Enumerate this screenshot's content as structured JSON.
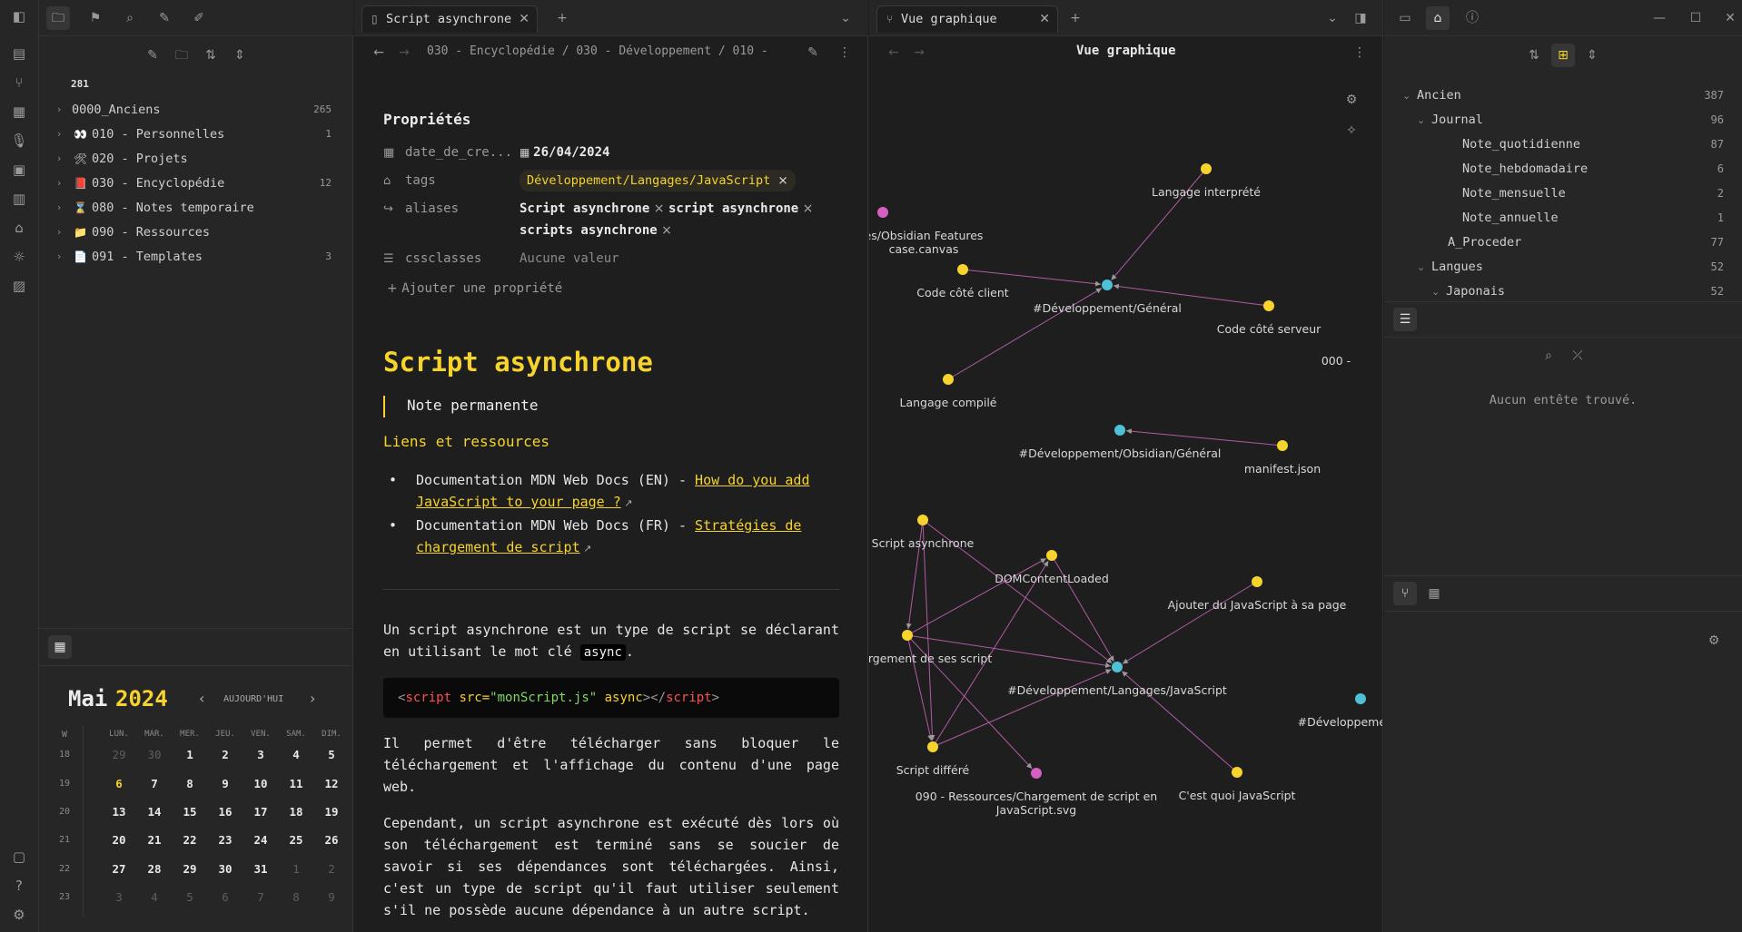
{
  "left_pane": {
    "total_count": "281",
    "folders": [
      {
        "emoji": "",
        "label": "0000_Anciens",
        "count": "265"
      },
      {
        "emoji": "👀",
        "label": "010 - Personnelles",
        "count": "1"
      },
      {
        "emoji": "🛠",
        "label": "020 - Projets",
        "count": ""
      },
      {
        "emoji": "📕",
        "label": "030 - Encyclopédie",
        "count": "12"
      },
      {
        "emoji": "⌛",
        "label": "080 - Notes temporaire",
        "count": ""
      },
      {
        "emoji": "📁",
        "label": "090 - Ressources",
        "count": ""
      },
      {
        "emoji": "📄",
        "label": "091 - Templates",
        "count": "3"
      }
    ]
  },
  "calendar": {
    "month": "Mai",
    "year": "2024",
    "today_label": "AUJOURD'HUI",
    "week_col": "W",
    "days_of_week": [
      "LUN.",
      "MAR.",
      "MER.",
      "JEU.",
      "VEN.",
      "SAM.",
      "DIM."
    ],
    "weeks": [
      {
        "wk": "18",
        "days": [
          "29",
          "30",
          "1",
          "2",
          "3",
          "4",
          "5"
        ]
      },
      {
        "wk": "19",
        "days": [
          "6",
          "7",
          "8",
          "9",
          "10",
          "11",
          "12"
        ]
      },
      {
        "wk": "20",
        "days": [
          "13",
          "14",
          "15",
          "16",
          "17",
          "18",
          "19"
        ]
      },
      {
        "wk": "21",
        "days": [
          "20",
          "21",
          "22",
          "23",
          "24",
          "25",
          "26"
        ]
      },
      {
        "wk": "22",
        "days": [
          "27",
          "28",
          "29",
          "30",
          "31",
          "1",
          "2"
        ]
      },
      {
        "wk": "23",
        "days": [
          "3",
          "4",
          "5",
          "6",
          "7",
          "8",
          "9"
        ]
      }
    ],
    "today": "6"
  },
  "editor": {
    "tab_title": "Script asynchrone",
    "breadcrumb": "030 - Encyclopédie / 030 - Développement / 010 -",
    "properties_title": "Propriétés",
    "props": {
      "date_key": "date_de_cre...",
      "date_value": "26/04/2024",
      "tags_key": "tags",
      "tag_value": "Développement/Langages/JavaScript",
      "aliases_key": "aliases",
      "alias_1": "Script asynchrone",
      "alias_2": "script asynchrone",
      "alias_3": "scripts asynchrone",
      "cssclasses_key": "cssclasses",
      "cssclasses_value": "Aucune valeur",
      "add_property": "Ajouter une propriété"
    },
    "title": "Script asynchrone",
    "callout": "Note permanente",
    "section_heading": "Liens et ressources",
    "links": [
      {
        "prefix": "Documentation MDN Web Docs (EN) - ",
        "text": "How do you add JavaScript to your page ?"
      },
      {
        "prefix": "Documentation MDN Web Docs (FR) - ",
        "text": "Stratégies de chargement de script"
      }
    ],
    "para1_before": "Un script asynchrone est un type de script se déclarant en utilisant le mot clé ",
    "para1_code": "async",
    "para1_after": ".",
    "code": {
      "lt": "<",
      "tag": "script",
      "attr": " src=",
      "str": "\"monScript.js\"",
      "attr2": " async",
      "gt_close": "></",
      "tag_close": "script",
      "gt": ">"
    },
    "para2": "Il permet d'être télécharger sans bloquer le téléchargement et l'affichage du contenu d'une page web.",
    "para3": "Cependant, un script asynchrone est exécuté dès lors où son téléchargement est terminé sans se soucier de savoir si ses dépendances sont téléchargées. Ainsi, c'est un type de script qu'il faut utiliser seulement s'il ne possède aucune dépendance à un autre script."
  },
  "graph": {
    "tab_title": "Vue graphique",
    "header_title": "Vue graphique",
    "colors": {
      "tag": "#4fc1d6",
      "note": "#f6d32d",
      "attachment": "#d65fc1",
      "edge": "#b35aa3"
    },
    "nodes": {
      "n1": "Langage interprété",
      "n2": "es/Obsidian Features",
      "n2b": "case.canvas",
      "n3": "Code côté client",
      "n4": "#Développement/Général",
      "n5": "Code côté serveur",
      "n6": "Langage compilé",
      "n7": "000 -",
      "n8": "#Développement/Obsidian/Général",
      "n9": "manifest.json",
      "n10": "Script asynchrone",
      "n11": "DOMContentLoaded",
      "n12": "Ajouter du JavaScript à sa page",
      "n13": "e chargement de ses script",
      "n14": "#Développement/Langages/JavaScript",
      "n15": "#Développement/Obs",
      "n16": "Script différé",
      "n17": "090 - Ressources/Chargement de script en",
      "n17b": "JavaScript.svg",
      "n18": "C'est quoi JavaScript"
    }
  },
  "right_pane": {
    "tree": [
      {
        "label": "Ancien",
        "count": "387",
        "level": 0,
        "chev": "v"
      },
      {
        "label": "Journal",
        "count": "96",
        "level": 1,
        "chev": "v"
      },
      {
        "label": "Note_quotidienne",
        "count": "87",
        "level": 2,
        "chev": ""
      },
      {
        "label": "Note_hebdomadaire",
        "count": "6",
        "level": 2,
        "chev": ""
      },
      {
        "label": "Note_mensuelle",
        "count": "2",
        "level": 2,
        "chev": ""
      },
      {
        "label": "Note_annuelle",
        "count": "1",
        "level": 2,
        "chev": ""
      },
      {
        "label": "A_Proceder",
        "count": "77",
        "level": 1,
        "chev": ""
      },
      {
        "label": "Langues",
        "count": "52",
        "level": 1,
        "chev": "v"
      },
      {
        "label": "Japonais",
        "count": "52",
        "level": 2,
        "chev": "v"
      }
    ],
    "outline_empty": "Aucun entête trouvé."
  }
}
